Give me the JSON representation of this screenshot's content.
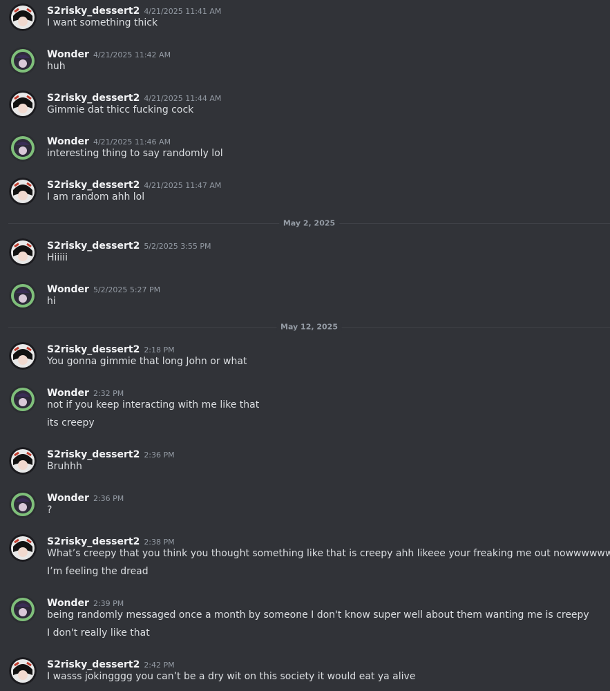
{
  "users": {
    "s2": "S2risky_dessert2",
    "wonder": "Wonder"
  },
  "dividers": [
    "May 2, 2025",
    "May 12, 2025"
  ],
  "messages": [
    {
      "author": "S2risky_dessert2",
      "time": "4/21/2025 11:41 AM",
      "lines": [
        "I want something thick"
      ]
    },
    {
      "author": "Wonder",
      "time": "4/21/2025 11:42 AM",
      "lines": [
        "huh"
      ]
    },
    {
      "author": "S2risky_dessert2",
      "time": "4/21/2025 11:44 AM",
      "lines": [
        "Gimmie dat thicc fucking cock"
      ]
    },
    {
      "author": "Wonder",
      "time": "4/21/2025 11:46 AM",
      "lines": [
        "interesting thing to say randomly lol"
      ]
    },
    {
      "author": "S2risky_dessert2",
      "time": "4/21/2025 11:47 AM",
      "lines": [
        "I am random ahh lol"
      ]
    },
    {
      "author": "S2risky_dessert2",
      "time": "5/2/2025 3:55 PM",
      "lines": [
        "Hiiiii"
      ]
    },
    {
      "author": "Wonder",
      "time": "5/2/2025 5:27 PM",
      "lines": [
        "hi"
      ]
    },
    {
      "author": "S2risky_dessert2",
      "time": "2:18 PM",
      "lines": [
        "You gonna gimmie that long John or what"
      ]
    },
    {
      "author": "Wonder",
      "time": "2:32 PM",
      "lines": [
        "not if you keep interacting with me like that",
        "its creepy"
      ]
    },
    {
      "author": "S2risky_dessert2",
      "time": "2:36 PM",
      "lines": [
        "Bruhhh"
      ]
    },
    {
      "author": "Wonder",
      "time": "2:36 PM",
      "lines": [
        "?"
      ]
    },
    {
      "author": "S2risky_dessert2",
      "time": "2:38 PM",
      "lines": [
        "What’s creepy that you think you thought something like that is creepy ahh likeee your freaking me out nowwwwww",
        "I’m feeling the dread"
      ]
    },
    {
      "author": "Wonder",
      "time": "2:39 PM",
      "lines": [
        "being randomly messaged once a month by someone I don't know super well about them wanting me is creepy",
        "I don't really like that"
      ]
    },
    {
      "author": "S2risky_dessert2",
      "time": "2:42 PM",
      "lines": [
        "I wasss jokingggg you can’t be a dry wit on this society it would eat ya alive"
      ]
    }
  ]
}
